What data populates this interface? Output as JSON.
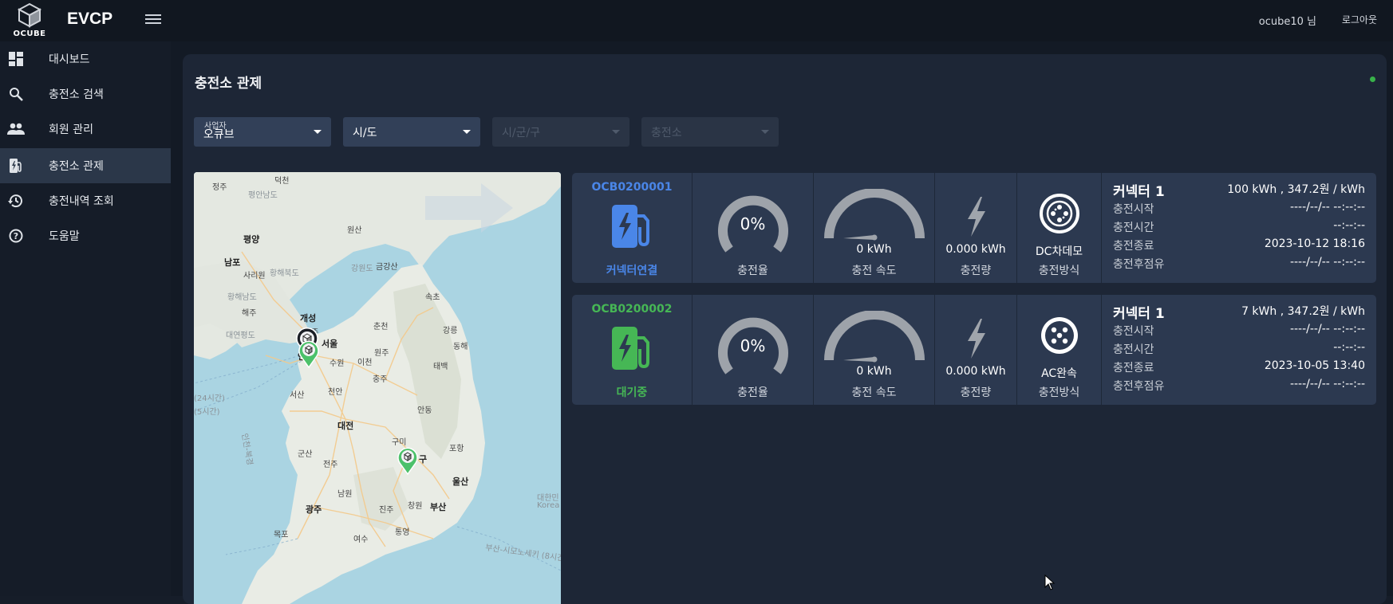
{
  "header": {
    "logo_text": "OCUBE",
    "app_title": "EVCP",
    "user": "ocube10 님",
    "logout": "로그아웃"
  },
  "sidebar": {
    "items": [
      {
        "label": "대시보드",
        "icon": "dashboard-icon"
      },
      {
        "label": "충전소 검색",
        "icon": "search-icon"
      },
      {
        "label": "회원 관리",
        "icon": "people-icon"
      },
      {
        "label": "충전소 관제",
        "icon": "charging-station-icon",
        "active": true
      },
      {
        "label": "충전내역 조회",
        "icon": "history-icon"
      },
      {
        "label": "도움말",
        "icon": "help-icon"
      }
    ]
  },
  "panel": {
    "title": "충전소 관제"
  },
  "filters": {
    "operator_label": "사업자",
    "operator_value": "오큐브",
    "sido_value": "시/도",
    "sigungu_placeholder": "시/군/구",
    "station_placeholder": "충전소"
  },
  "map": {
    "labels": [
      "정주",
      "덕천",
      "평안남도",
      "원산",
      "평양",
      "남포",
      "강원도",
      "금강산",
      "사리원",
      "황해북도",
      "황해남도",
      "해주",
      "속초",
      "개성",
      "파주",
      "춘천",
      "강릉",
      "대연평도",
      "서울",
      "동해",
      "인천",
      "수원",
      "이천",
      "원주",
      "태백",
      "서산",
      "천안",
      "충주",
      "안동",
      "대전",
      "구미",
      "포항",
      "군산",
      "전주",
      "구",
      "울산",
      "남원",
      "광주",
      "진주",
      "창원",
      "부산",
      "목포",
      "여수",
      "통영",
      "대한민",
      "Korea S",
      "부산-시모노세키 (8시간30",
      "(24시간)",
      "(5시간)",
      "인천-북경"
    ]
  },
  "stations": [
    {
      "id": "OCB0200001",
      "status": "커넥터연결",
      "status_color": "#4a86e8",
      "charge_rate": "0%",
      "speed": "0 kWh",
      "speed_label": "충전 속도",
      "rate_label": "충전율",
      "amount": "0.000 kWh",
      "amount_label": "충전량",
      "method": "DC차데모",
      "method_label": "충전방식",
      "connector": "커넥터 1",
      "spec": "100 kWh , 347.2원 / kWh",
      "rows": [
        {
          "k": "충전시작",
          "v": "----/--/-- --:--:--"
        },
        {
          "k": "충전시간",
          "v": "--:--:--"
        },
        {
          "k": "충전종료",
          "v": "2023-10-12 18:16"
        },
        {
          "k": "충전후점유",
          "v": "----/--/-- --:--:--"
        }
      ]
    },
    {
      "id": "OCB0200002",
      "status": "대기중",
      "status_color": "#46b755",
      "charge_rate": "0%",
      "speed": "0 kWh",
      "speed_label": "충전 속도",
      "rate_label": "충전율",
      "amount": "0.000 kWh",
      "amount_label": "충전량",
      "method": "AC완속",
      "method_label": "충전방식",
      "connector": "커넥터 1",
      "spec": "7 kWh , 347.2원 / kWh",
      "rows": [
        {
          "k": "충전시작",
          "v": "----/--/-- --:--:--"
        },
        {
          "k": "충전시간",
          "v": "--:--:--"
        },
        {
          "k": "충전종료",
          "v": "2023-10-05 13:40"
        },
        {
          "k": "충전후점유",
          "v": "----/--/-- --:--:--"
        }
      ]
    }
  ]
}
